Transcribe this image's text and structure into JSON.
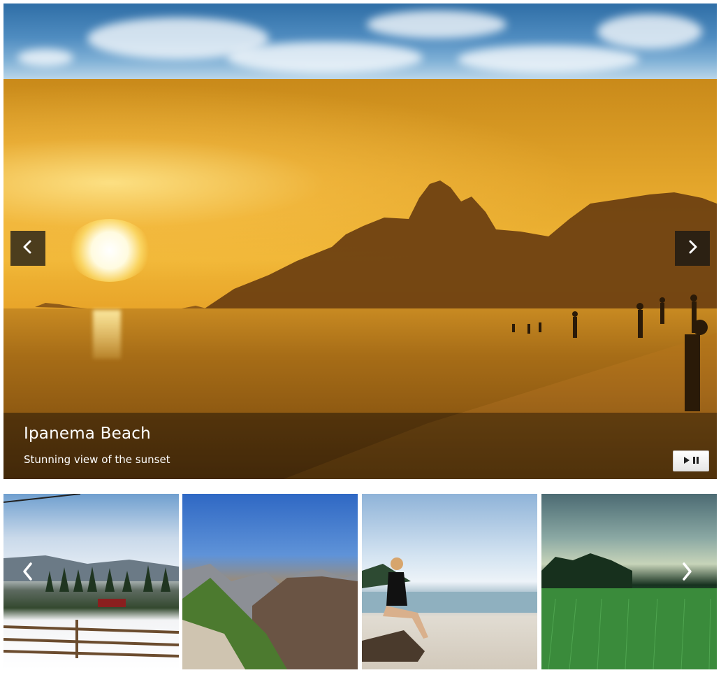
{
  "slider": {
    "caption_title": "Ipanema Beach",
    "caption_description": "Stunning view of the sunset"
  },
  "icons": {
    "prev": "chevron-left-icon",
    "next": "chevron-right-icon",
    "play_pause": "play-pause-icon"
  },
  "thumbnails": [
    {
      "subject": "snowy-ranch"
    },
    {
      "subject": "mountain-valley"
    },
    {
      "subject": "woman-on-beach"
    },
    {
      "subject": "green-field"
    }
  ]
}
